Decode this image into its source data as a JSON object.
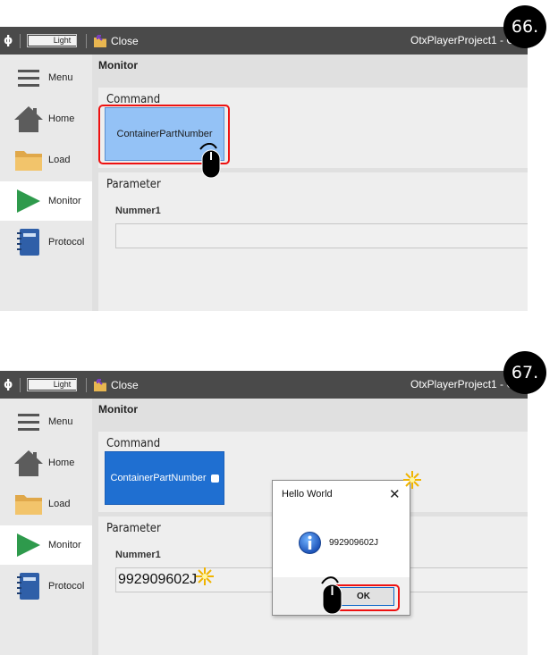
{
  "screens": [
    {
      "step": "66.",
      "titlebar": {
        "theme_label": "Light",
        "close_label": "Close",
        "app_title": "OtxPlayerProject1 - C"
      },
      "sidebar": {
        "items": [
          {
            "label": "Menu"
          },
          {
            "label": "Home"
          },
          {
            "label": "Load"
          },
          {
            "label": "Monitor"
          },
          {
            "label": "Protocol"
          }
        ]
      },
      "section_title": "Monitor",
      "command": {
        "caption": "Command",
        "button_label": "ContainerPartNumber"
      },
      "parameter": {
        "caption": "Parameter",
        "field_label": "Nummer1",
        "value": ""
      }
    },
    {
      "step": "67.",
      "titlebar": {
        "theme_label": "Light",
        "close_label": "Close",
        "app_title": "OtxPlayerProject1 - C"
      },
      "sidebar": {
        "items": [
          {
            "label": "Menu"
          },
          {
            "label": "Home"
          },
          {
            "label": "Load"
          },
          {
            "label": "Monitor"
          },
          {
            "label": "Protocol"
          }
        ]
      },
      "section_title": "Monitor",
      "command": {
        "caption": "Command",
        "button_label": "ContainerPartNumber"
      },
      "parameter": {
        "caption": "Parameter",
        "field_label": "Nummer1",
        "value": "992909602J"
      },
      "dialog": {
        "title": "Hello World",
        "message": "992909602J",
        "ok_label": "OK"
      }
    }
  ],
  "colors": {
    "titlebar": "#4a4a4a",
    "accent_blue": "#1f6fd1",
    "hover_blue": "#94c2f6",
    "highlight_red": "#e11111",
    "monitor_green": "#2e9a4c"
  }
}
